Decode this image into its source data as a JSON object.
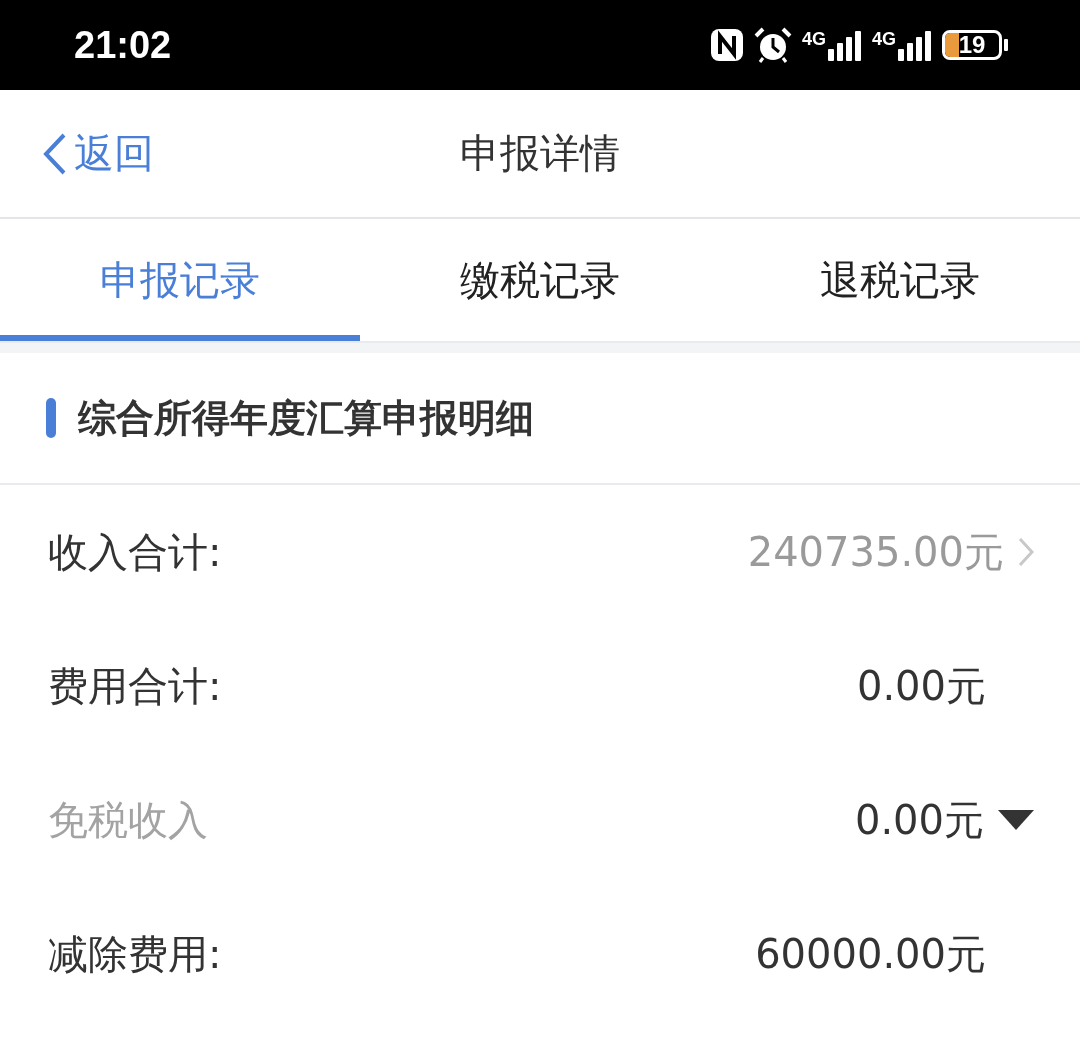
{
  "status_bar": {
    "time": "21:02",
    "network_1": "4G",
    "network_2": "4G",
    "battery": "19"
  },
  "nav": {
    "back": "返回",
    "title": "申报详情"
  },
  "tabs": [
    {
      "label": "申报记录",
      "selected": true
    },
    {
      "label": "缴税记录",
      "selected": false
    },
    {
      "label": "退税记录",
      "selected": false
    }
  ],
  "section": {
    "title": "综合所得年度汇算申报明细"
  },
  "rows": [
    {
      "label": "收入合计:",
      "value": "240735.00元",
      "kind": "link",
      "muted": false
    },
    {
      "label": "费用合计:",
      "value": "0.00元",
      "kind": "plain",
      "muted": false
    },
    {
      "label": "免税收入",
      "value": "0.00元",
      "kind": "dropdown",
      "muted": true
    },
    {
      "label": "减除费用:",
      "value": "60000.00元",
      "kind": "plain",
      "muted": false
    }
  ]
}
